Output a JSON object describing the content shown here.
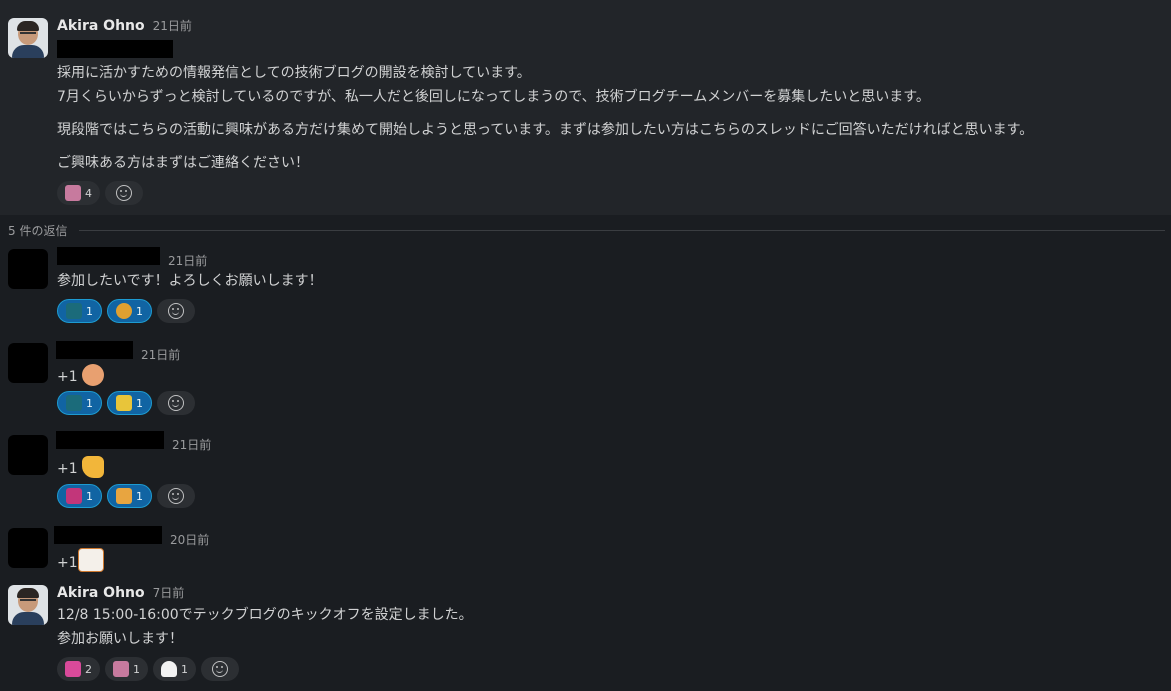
{
  "parent": {
    "author": "Akira Ohno",
    "time": "21日前",
    "lines": [
      "採用に活かすための情報発信としての技術ブログの開設を検討しています。",
      "7月くらいからずっと検討しているのですが、私一人だと後回しになってしまうので、技術ブログチームメンバーを募集したいと思います。",
      "現段階ではこちらの活動に興味がある方だけ集めて開始しようと思っています。まずは参加したい方はこちらのスレッドにご回答いただければと思います。",
      "ご興味ある方はまずはご連絡ください！"
    ],
    "reactions": [
      {
        "emoji": "party-icon",
        "count": "4",
        "color": "#c77a9e"
      }
    ]
  },
  "thread": {
    "reply_count_label": "5 件の返信"
  },
  "replies": [
    {
      "time": "21日前",
      "text": "参加したいです！よろしくお願いします！",
      "reactions": [
        {
          "emoji": "grid-icon",
          "count": "1",
          "color": "#1b6b7a",
          "mine": true
        },
        {
          "emoji": "crying-face-icon",
          "count": "1",
          "color": "#e0a030",
          "mine": true
        }
      ]
    },
    {
      "time": "21日前",
      "text": "+1",
      "inline_emoji": "raising-hand-icon",
      "reactions": [
        {
          "emoji": "grid-icon",
          "count": "1",
          "color": "#1b6b7a",
          "mine": true
        },
        {
          "emoji": "sparkles-icon",
          "count": "1",
          "color": "#e8c53a",
          "mine": true
        }
      ]
    },
    {
      "time": "21日前",
      "text": "+1",
      "inline_emoji": "thumbs-up-icon",
      "reactions": [
        {
          "emoji": "pink-badge-icon",
          "count": "1",
          "color": "#c2367a",
          "mine": true
        },
        {
          "emoji": "rock-hand-icon",
          "count": "1",
          "color": "#e8a540",
          "mine": true
        }
      ]
    },
    {
      "time": "20日前",
      "text": "+1",
      "inline_emoji": "cat-sticker-icon",
      "reactions": []
    },
    {
      "author": "Akira Ohno",
      "time": "7日前",
      "lines": [
        "12/8 15:00-16:00でテックブログのキックオフを設定しました。",
        "参加お願いします！"
      ],
      "reactions": [
        {
          "emoji": "ryokai-desu-icon",
          "count": "2",
          "color": "#d94a9a"
        },
        {
          "emoji": "party-icon",
          "count": "1",
          "color": "#c77a9e"
        },
        {
          "emoji": "onigiri-icon",
          "count": "1",
          "color": "#f2f2f2"
        }
      ]
    }
  ]
}
